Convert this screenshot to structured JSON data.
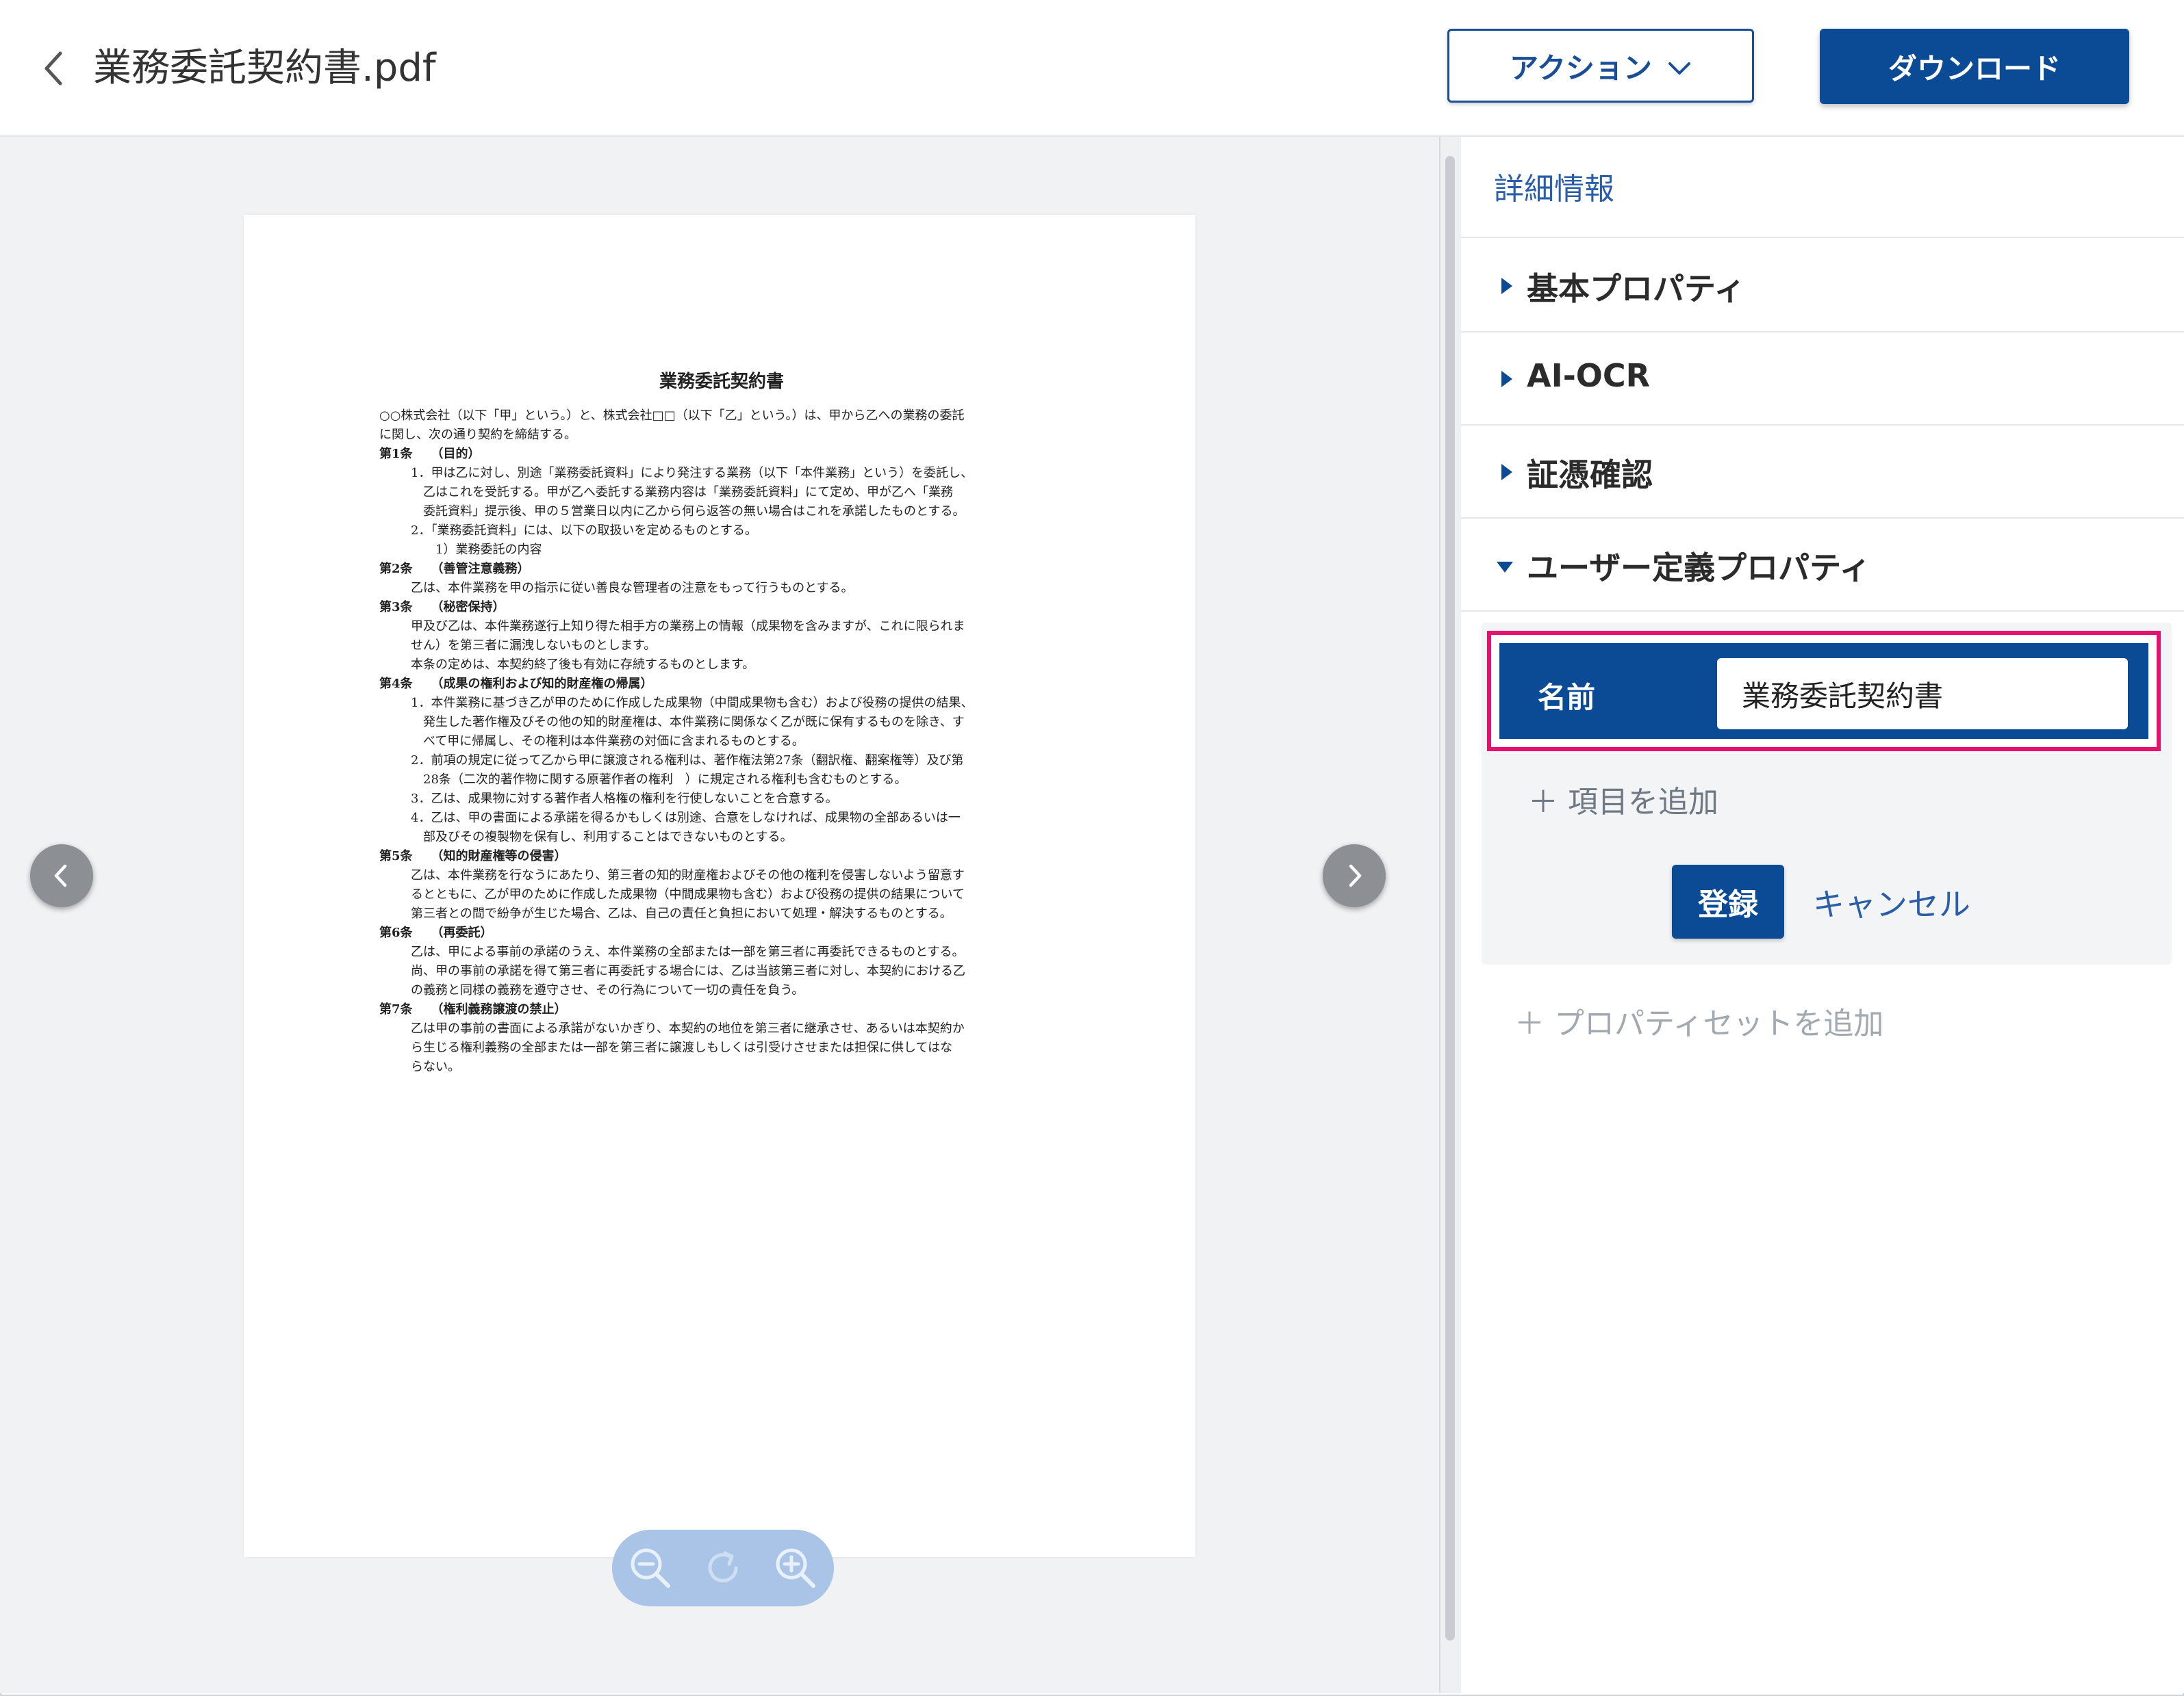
{
  "header": {
    "file_name": "業務委託契約書.pdf",
    "action_label": "アクション",
    "download_label": "ダウンロード"
  },
  "document": {
    "title": "業務委託契約書",
    "intro": [
      "○○株式会社（以下「甲」という。）と、株式会社□□（以下「乙」という。）は、甲から乙への業務の委託",
      "に関し、次の通り契約を締結する。"
    ],
    "articles": [
      {
        "head": "第1条　　（目的）",
        "lines": [
          "1．甲は乙に対し、別途「業務委託資料」により発注する業務（以下「本件業務」という）を委託し、",
          "　乙はこれを受託する。甲が乙へ委託する業務内容は「業務委託資料」にて定め、甲が乙へ「業務",
          "　委託資料」提示後、甲の５営業日以内に乙から何ら返答の無い場合はこれを承諾したものとする。",
          "2．「業務委託資料」には、以下の取扱いを定めるものとする。",
          "　　1）業務委託の内容"
        ]
      },
      {
        "head": "第2条　　（善管注意義務）",
        "lines": [
          "乙は、本件業務を甲の指示に従い善良な管理者の注意をもって行うものとする。"
        ]
      },
      {
        "head": "第3条　　（秘密保持）",
        "lines": [
          "甲及び乙は、本件業務遂行上知り得た相手方の業務上の情報（成果物を含みますが、これに限られま",
          "せん）を第三者に漏洩しないものとします。",
          "本条の定めは、本契約終了後も有効に存続するものとします。"
        ]
      },
      {
        "head": "第4条　　（成果の権利および知的財産権の帰属）",
        "lines": [
          "1．本件業務に基づき乙が甲のために作成した成果物（中間成果物も含む）および役務の提供の結果、",
          "　発生した著作権及びその他の知的財産権は、本件業務に関係なく乙が既に保有するものを除き、す",
          "　べて甲に帰属し、その権利は本件業務の対価に含まれるものとする。",
          "2．前項の規定に従って乙から甲に譲渡される権利は、著作権法第27条（翻訳権、翻案権等）及び第",
          "　28条（二次的著作物に関する原著作者の権利　）に規定される権利も含むものとする。",
          "3．乙は、成果物に対する著作者人格権の権利を行使しないことを合意する。",
          "4．乙は、甲の書面による承諾を得るかもしくは別途、合意をしなければ、成果物の全部あるいは一",
          "　部及びその複製物を保有し、利用することはできないものとする。"
        ]
      },
      {
        "head": "第5条　　（知的財産権等の侵害）",
        "lines": [
          "乙は、本件業務を行なうにあたり、第三者の知的財産権およびその他の権利を侵害しないよう留意す",
          "るとともに、乙が甲のために作成した成果物（中間成果物も含む）および役務の提供の結果について",
          "第三者との間で紛争が生じた場合、乙は、自己の責任と負担において処理・解決するものとする。"
        ]
      },
      {
        "head": "第6条　　（再委託）",
        "lines": [
          "乙は、甲による事前の承諾のうえ、本件業務の全部または一部を第三者に再委託できるものとする。",
          "尚、甲の事前の承諾を得て第三者に再委託する場合には、乙は当該第三者に対し、本契約における乙",
          "の義務と同様の義務を遵守させ、その行為について一切の責任を負う。"
        ]
      },
      {
        "head": "第7条　　（権利義務譲渡の禁止）",
        "lines": [
          "乙は甲の事前の書面による承諾がないかぎり、本契約の地位を第三者に継承させ、あるいは本契約か",
          "ら生じる権利義務の全部または一部を第三者に譲渡しもしくは引受けさせまたは担保に供してはな",
          "らない。"
        ]
      }
    ]
  },
  "panel": {
    "title": "詳細情報",
    "sections": [
      {
        "label": "基本プロパティ",
        "expanded": false
      },
      {
        "label": "AI-OCR",
        "expanded": false
      },
      {
        "label": "証憑確認",
        "expanded": false
      },
      {
        "label": "ユーザー定義プロパティ",
        "expanded": true
      }
    ],
    "user_property": {
      "label": "名前",
      "value": "業務委託契約書"
    },
    "add_item": "項目を追加",
    "register": "登録",
    "cancel": "キャンセル",
    "add_property_set": "プロパティセットを追加"
  },
  "colors": {
    "primary": "#0b4a95",
    "link": "#2a5ea8",
    "highlight": "#e6116f",
    "zoom_bar": "#a9c4e6"
  },
  "icons": {
    "back": "chevron-left-icon",
    "action_dropdown": "chevron-down-icon",
    "prev_page": "chevron-left-circle-icon",
    "next_page": "chevron-right-circle-icon",
    "zoom_out": "zoom-out-icon",
    "rotate": "rotate-icon",
    "zoom_in": "zoom-in-icon"
  }
}
